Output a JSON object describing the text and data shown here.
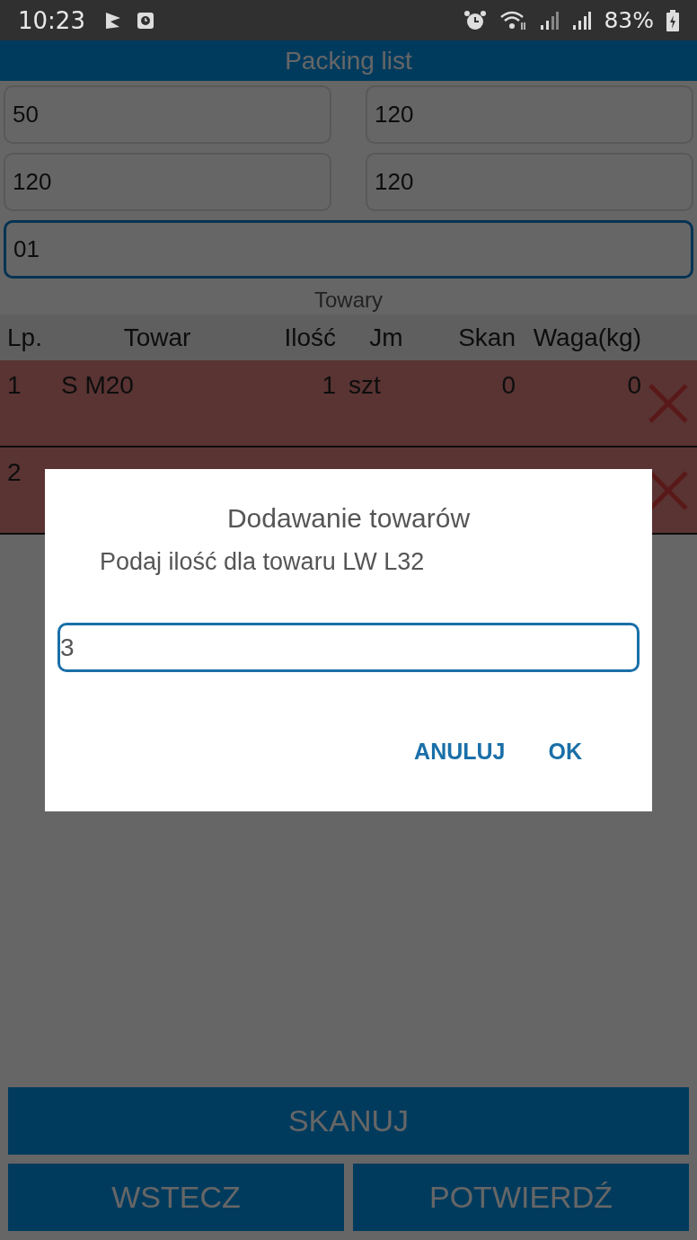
{
  "status_bar": {
    "time": "10:23",
    "battery": "83%"
  },
  "title": "Packing list",
  "fields": [
    {
      "value": "50",
      "focused": false
    },
    {
      "value": "120",
      "focused": false
    },
    {
      "value": "120",
      "focused": false
    },
    {
      "value": "120",
      "focused": false
    },
    {
      "value": "01",
      "focused": true
    }
  ],
  "section_label": "Towary",
  "table": {
    "columns": [
      "Lp.",
      "Towar",
      "Ilość",
      "Jm",
      "Skan",
      "Waga(kg)"
    ],
    "rows": [
      {
        "cells": [
          "1",
          "S M20",
          "1",
          "szt",
          "0",
          "0"
        ]
      },
      {
        "cells": [
          "2"
        ]
      }
    ]
  },
  "buttons": [
    "SKANUJ",
    "WSTECZ",
    "POTWIERDŹ"
  ],
  "dialog": {
    "title": "Dodawanie towarów",
    "message": "Podaj ilość dla towaru LW L32",
    "value": "3",
    "buttons": [
      "ANULUJ",
      "OK"
    ]
  }
}
